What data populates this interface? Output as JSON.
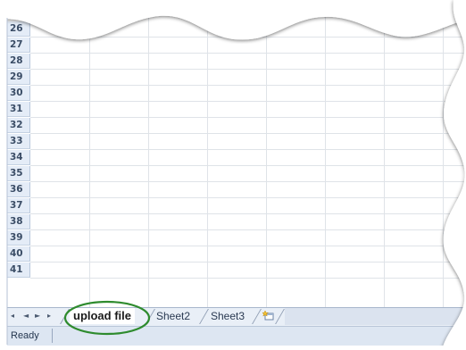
{
  "grid": {
    "row_numbers": [
      "26",
      "27",
      "28",
      "29",
      "30",
      "31",
      "32",
      "33",
      "34",
      "35",
      "36",
      "37",
      "38",
      "39",
      "40",
      "41"
    ]
  },
  "tabbar": {
    "nav_first": "◂",
    "nav_prev": "◄",
    "nav_next": "►",
    "nav_last": "▸",
    "sheets": [
      {
        "label": "upload file",
        "active": true
      },
      {
        "label": "Sheet2",
        "active": false
      },
      {
        "label": "Sheet3",
        "active": false
      }
    ],
    "new_sheet_icon": "insert-worksheet-icon"
  },
  "statusbar": {
    "status": "Ready"
  },
  "colors": {
    "row_header_bg": "#e4ecf7",
    "grid_line": "#dfe3e8",
    "highlight_ellipse": "#2e8b2e",
    "tabbar_bg": "#e9eff7",
    "statusbar_bg": "#dde6f2"
  }
}
